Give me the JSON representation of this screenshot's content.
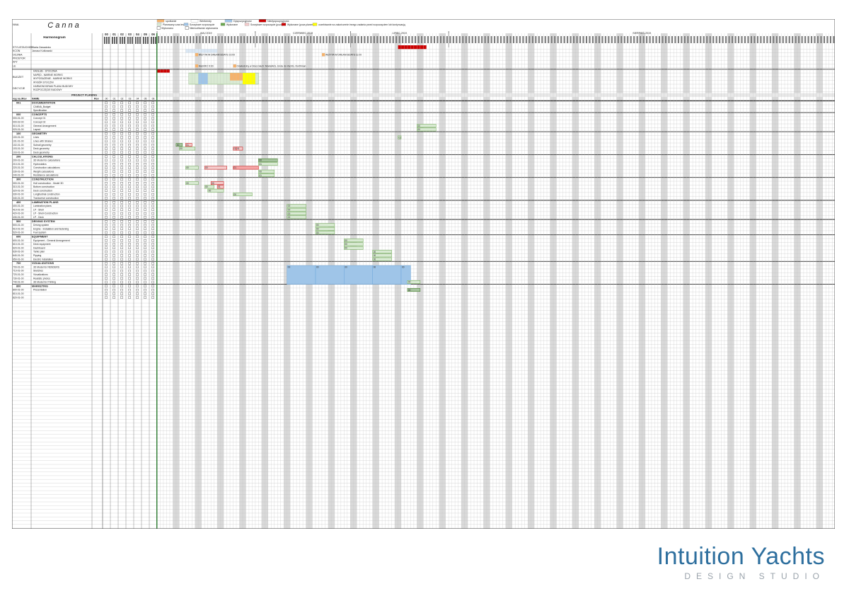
{
  "legend": {
    "row1": [
      "spotkanie",
      "Weekendy",
      "Dyspozycyjność",
      "Niedyspozycyjność"
    ],
    "row2": [
      "Planowany czas trwania",
      "Szczytowe rozpoczęcie",
      "Wykonane",
      "Szczytowe rozpoczęcie (poza)",
      "Wykonane (poza planem)",
      "oczekiwanie na zakończenie innego zadania przed rozpoczęciem lub kontynuacją"
    ],
    "row3": [
      "Wykonano",
      "Niemożliwość wykonania"
    ]
  },
  "header": {
    "nna_label": "NNA",
    "logo_text": "Canna",
    "title": "Harmonogram",
    "rev_numbers": [
      "00",
      "01",
      "02",
      "03",
      "04",
      "05",
      "06"
    ],
    "months": [
      "MAJ 2019",
      "CZERWIEC 2019",
      "LIPIEC 2019",
      "SIERPIEŃ 2019"
    ]
  },
  "people": [
    {
      "role": "STYLISTA/CHIEF",
      "name": "Marta Zawadzka"
    },
    {
      "role": "KCON",
      "name": "Janusz Kutkowski"
    },
    {
      "role": "OCZNIA",
      "name": ""
    },
    {
      "role": "PROSTOR",
      "name": ""
    },
    {
      "role": "PPT",
      "name": ""
    },
    {
      "role": "LE",
      "name": ""
    }
  ],
  "people_notes": [
    {
      "text": "WIZYTA W DREAM BOATS 10:00"
    },
    {
      "text": "WIZYTA W DREAM BOATS 11:00"
    },
    {
      "text": "MaDIRO 9:00"
    },
    {
      "text": "Odwiedziny w Stoczniach: ModelArts, Enda do Yachts, Northman"
    }
  ],
  "budget": {
    "groups": [
      {
        "label": "BUDŻET",
        "items": [
          "KADŁUB - STOCZNIA",
          "NAPĘD - MARINE WORKS",
          "WYPOSAŻENIE - MARINE WORKS",
          "WYBÓR STOCZNI"
        ]
      },
      {
        "label": "DECYZJE",
        "items": [
          "HARMONOGRAM PLANU BUDOWY",
          "ROZPOCZĘCIE BUDOWY"
        ]
      }
    ]
  },
  "project_planning_label": "PROJECT PLANING",
  "table_header": {
    "reg": "reg no./Rev",
    "name": "NAME",
    "rev": "Rev"
  },
  "sections": [
    {
      "code": "001",
      "title": "DOCUMENTATION",
      "rows": [
        {
          "code": "",
          "name": "CANNA_Budget"
        },
        {
          "code": "",
          "name": "Specification"
        }
      ]
    },
    {
      "code": "000",
      "title": "CONCEPTS",
      "rows": [
        {
          "code": "000-01-00",
          "name": "Concept 01"
        },
        {
          "code": "000-02-00",
          "name": "Concept 02"
        },
        {
          "code": "010-01-00",
          "name": "General Arrangement"
        },
        {
          "code": "020-01-00",
          "name": "Layout"
        }
      ]
    },
    {
      "code": "100",
      "title": "GEOMETRY",
      "rows": [
        {
          "code": "100-01-00",
          "name": "Lines"
        },
        {
          "code": "101-01-00",
          "name": "Lines with Strakes"
        },
        {
          "code": "102-01-00",
          "name": "Subrail geometry"
        },
        {
          "code": "103-01-00",
          "name": "Deck geometry"
        },
        {
          "code": "103-01-00",
          "name": "Deck geometry"
        }
      ]
    },
    {
      "code": "200",
      "title": "CALCULATIONS",
      "rows": [
        {
          "code": "200-01-00",
          "name": "3D Model for calculations"
        },
        {
          "code": "210-01-00",
          "name": "Hydrostatics"
        },
        {
          "code": "220-01-00",
          "name": "Construction calculations"
        },
        {
          "code": "230-01-00",
          "name": "Weight calculations"
        },
        {
          "code": "240-01-00",
          "name": "Resistance calculations"
        }
      ]
    },
    {
      "code": "300",
      "title": "CONSTRUCTION",
      "rows": [
        {
          "code": "300-01-00",
          "name": "Hull construction - Model 3D"
        },
        {
          "code": "310-01-00",
          "name": "Bottom construction"
        },
        {
          "code": "320-01-00",
          "name": "Deck construction"
        },
        {
          "code": "330-01-00",
          "name": "Longitudinal construction"
        },
        {
          "code": "340-01-00",
          "name": "Transverse construction"
        }
      ]
    },
    {
      "code": "400",
      "title": "LAMINATION PLANS",
      "rows": [
        {
          "code": "400-01-00",
          "name": "Lamination plans"
        },
        {
          "code": "410-01-00",
          "name": "LP - Shell"
        },
        {
          "code": "420-01-00",
          "name": "LP - Shell-Construction"
        },
        {
          "code": "430-01-00",
          "name": "LP - Deck"
        }
      ]
    },
    {
      "code": "500",
      "title": "DRIVING SYSTEM",
      "rows": [
        {
          "code": "500-01-00",
          "name": "Driving system"
        },
        {
          "code": "510-01-00",
          "name": "Engine - instalation and fastening"
        },
        {
          "code": "520-01-00",
          "name": "Fuel system"
        }
      ]
    },
    {
      "code": "600",
      "title": "EQUIPMENT",
      "rows": [
        {
          "code": "600-01-00",
          "name": "Equipment - General Arrangement"
        },
        {
          "code": "610-01-00",
          "name": "Deck equipment"
        },
        {
          "code": "620-01-00",
          "name": "Dashboard"
        },
        {
          "code": "630-01-00",
          "name": "Tanks plan"
        },
        {
          "code": "640-01-00",
          "name": "Pipping"
        },
        {
          "code": "650-01-00",
          "name": "Electric installation"
        }
      ]
    },
    {
      "code": "700",
      "title": "VIZUALIZATIONS",
      "rows": [
        {
          "code": "700-01-00",
          "name": "3D Model for RENDERS"
        },
        {
          "code": "710-01-00",
          "name": "Sketches"
        },
        {
          "code": "720-01-00",
          "name": "Vizualizations"
        },
        {
          "code": "730-01-00",
          "name": "Realistic photos"
        },
        {
          "code": "740-01-00",
          "name": "3D Model for Printing"
        }
      ]
    },
    {
      "code": "800",
      "title": "MARKETING",
      "rows": [
        {
          "code": "800-01-00",
          "name": "Presentation"
        },
        {
          "code": "810-01-00",
          "name": ""
        },
        {
          "code": "820-01-00",
          "name": ""
        }
      ]
    }
  ],
  "bars": [
    {
      "code": "010-01-00",
      "label": "00",
      "kind": "planned",
      "start": 82,
      "end": 88
    },
    {
      "code": "020-01-00",
      "label": "00",
      "kind": "planned",
      "start": 82,
      "end": 88
    },
    {
      "code": "100-01-00",
      "label": "01",
      "kind": "planned",
      "start": 76,
      "end": 77
    },
    {
      "code": "102-01-00",
      "label": "00",
      "kind": "done",
      "start": 6,
      "end": 8
    },
    {
      "code": "102-01-00",
      "label": "01",
      "kind": "late",
      "start": 9,
      "end": 11
    },
    {
      "code": "103-01-00",
      "label": "00",
      "kind": "planned",
      "start": 7,
      "end": 12
    },
    {
      "code": "103-01-00",
      "label": "01",
      "kind": "late",
      "start": 24,
      "end": 25
    },
    {
      "code": "103-01-00",
      "label": "01",
      "kind": "late",
      "start": 25,
      "end": 27
    },
    {
      "code": "200-01-00",
      "label": "00",
      "kind": "done",
      "start": 32,
      "end": 38
    },
    {
      "code": "210-01-00",
      "label": "01",
      "kind": "planned",
      "start": 32,
      "end": 38
    },
    {
      "code": "220-01-00",
      "label": "00",
      "kind": "planned",
      "start": 9,
      "end": 13
    },
    {
      "code": "220-01-00",
      "label": "00",
      "kind": "late",
      "start": 15,
      "end": 22
    },
    {
      "code": "220-01-00",
      "label": "01",
      "kind": "outside",
      "start": 24,
      "end": 32
    },
    {
      "code": "230-01-00",
      "label": "00",
      "kind": "planned",
      "start": 32,
      "end": 37
    },
    {
      "code": "240-01-00",
      "label": "01",
      "kind": "planned",
      "start": 32,
      "end": 37
    },
    {
      "code": "300-01-00",
      "label": "00",
      "kind": "planned",
      "start": 9,
      "end": 13
    },
    {
      "code": "300-01-00",
      "label": "00",
      "kind": "late",
      "start": 17,
      "end": 21
    },
    {
      "code": "310-01-00",
      "label": "00",
      "kind": "planned",
      "start": 15,
      "end": 18
    },
    {
      "code": "310-01-00",
      "label": "01",
      "kind": "late",
      "start": 19,
      "end": 21
    },
    {
      "code": "320-01-00",
      "label": "00",
      "kind": "planned",
      "start": 16,
      "end": 21
    },
    {
      "code": "330-01-00",
      "label": "00",
      "kind": "planned",
      "start": 24,
      "end": 30
    },
    {
      "code": "400-01-00",
      "label": "00",
      "kind": "planned",
      "start": 41,
      "end": 47
    },
    {
      "code": "410-01-00",
      "label": "00",
      "kind": "planned",
      "start": 41,
      "end": 47
    },
    {
      "code": "420-01-00",
      "label": "00",
      "kind": "planned",
      "start": 41,
      "end": 47
    },
    {
      "code": "430-01-00",
      "label": "00",
      "kind": "planned",
      "start": 41,
      "end": 47
    },
    {
      "code": "500-01-00",
      "label": "00",
      "kind": "planned",
      "start": 50,
      "end": 56
    },
    {
      "code": "510-01-00",
      "label": "00",
      "kind": "planned",
      "start": 50,
      "end": 56
    },
    {
      "code": "520-01-00",
      "label": "00",
      "kind": "planned",
      "start": 50,
      "end": 56
    },
    {
      "code": "600-01-00",
      "label": "00",
      "kind": "planned",
      "start": 59,
      "end": 65
    },
    {
      "code": "610-01-00",
      "label": "00",
      "kind": "planned",
      "start": 59,
      "end": 65
    },
    {
      "code": "620-01-00",
      "label": "00",
      "kind": "planned",
      "start": 59,
      "end": 65
    },
    {
      "code": "630-01-00",
      "label": "00",
      "kind": "planned",
      "start": 68,
      "end": 74
    },
    {
      "code": "640-01-00",
      "label": "00",
      "kind": "planned",
      "start": 68,
      "end": 74
    },
    {
      "code": "650-01-00",
      "label": "00",
      "kind": "planned",
      "start": 68,
      "end": 74
    },
    {
      "code": "700-01-00",
      "label": "00",
      "kind": "blue",
      "start": 41,
      "end": 50
    },
    {
      "code": "700-01-00",
      "label": "00",
      "kind": "blue",
      "start": 50,
      "end": 59
    },
    {
      "code": "700-01-00",
      "label": "00",
      "kind": "blue",
      "start": 59,
      "end": 68
    },
    {
      "code": "700-01-00",
      "label": "00",
      "kind": "blue",
      "start": 68,
      "end": 77
    },
    {
      "code": "700-01-00",
      "label": "00",
      "kind": "blue",
      "start": 77,
      "end": 80
    },
    {
      "code": "740-01-00",
      "label": "00",
      "kind": "planned",
      "start": 79,
      "end": 83
    },
    {
      "code": "800-01-00",
      "label": "00",
      "kind": "done",
      "start": 79,
      "end": 83
    }
  ],
  "colors": {
    "weekend": "#d9d9d9",
    "planned": "#d9ead3",
    "planned_stroke": "#6aa84f",
    "late": "#f4cccc",
    "late_stroke": "#cc0000",
    "blue": "#9fc5e8",
    "orange": "#f6b26b",
    "yellow": "#ffff00",
    "red": "#cc0000",
    "grid": "#bdbdbd"
  },
  "branding": {
    "name": "Intuition Yachts",
    "sub": "DESIGN STUDIO"
  }
}
